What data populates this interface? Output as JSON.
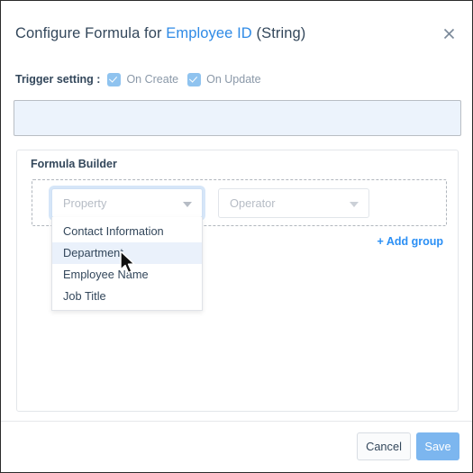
{
  "dialog": {
    "title_prefix": "Configure Formula for ",
    "title_field": "Employee ID",
    "title_suffix": " (String)",
    "close_icon": "close-icon"
  },
  "trigger": {
    "label": "Trigger setting :",
    "options": [
      {
        "label": "On Create",
        "checked": true
      },
      {
        "label": "On Update",
        "checked": true
      }
    ]
  },
  "preview": {
    "value": "",
    "background_color": "#ecf3fc"
  },
  "builder": {
    "heading": "Formula Builder",
    "property_select": {
      "placeholder": "Property",
      "value": "",
      "caret_icon": "chevron-down-icon"
    },
    "operator_select": {
      "placeholder": "Operator",
      "value": "",
      "caret_icon": "chevron-down-icon"
    },
    "dropdown_options": [
      {
        "label": "Contact Information",
        "highlighted": false
      },
      {
        "label": "Department",
        "highlighted": true
      },
      {
        "label": "Employee Name",
        "highlighted": false
      },
      {
        "label": "Job Title",
        "highlighted": false
      }
    ],
    "add_group": {
      "plus": "+",
      "label": "Add group"
    }
  },
  "footer": {
    "cancel_label": "Cancel",
    "save_label": "Save"
  },
  "colors": {
    "accent_blue": "#2a8ff5",
    "title_link": "#2e8ae6",
    "checkbox_blue": "#8fc3ef",
    "save_button": "#7cb6ef",
    "highlight_row": "#eaf1fb",
    "text_dark": "#33475b",
    "placeholder_gray": "#b6bcc5"
  }
}
